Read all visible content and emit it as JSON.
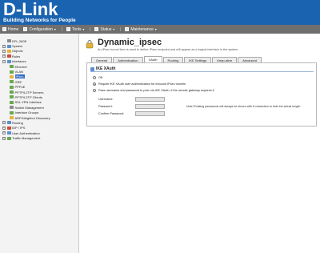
{
  "header": {
    "logo": "D-Link",
    "tagline": "Building Networks for People"
  },
  "menu": {
    "items": [
      {
        "label": "Home"
      },
      {
        "label": "Configuration"
      },
      {
        "label": "Tools"
      },
      {
        "label": "Status"
      },
      {
        "label": "Maintenance"
      }
    ]
  },
  "sidebar": {
    "items": [
      {
        "label": "DFL-260E",
        "depth": 0,
        "toggle": "",
        "icon": "gray"
      },
      {
        "label": "System",
        "depth": 0,
        "toggle": "+",
        "icon": "blue"
      },
      {
        "label": "Objects",
        "depth": 0,
        "toggle": "+",
        "icon": "yellow"
      },
      {
        "label": "Rules",
        "depth": 0,
        "toggle": "+",
        "icon": "red"
      },
      {
        "label": "Interfaces",
        "depth": 0,
        "toggle": "-",
        "icon": "blue"
      },
      {
        "label": "Ethernet",
        "depth": 1,
        "toggle": "",
        "icon": "green"
      },
      {
        "label": "VLAN",
        "depth": 1,
        "toggle": "",
        "icon": "green"
      },
      {
        "label": "IPsec",
        "depth": 1,
        "toggle": "",
        "icon": "yellow",
        "selected": true
      },
      {
        "label": "GRE",
        "depth": 1,
        "toggle": "",
        "icon": "green"
      },
      {
        "label": "PPPoE",
        "depth": 1,
        "toggle": "",
        "icon": "green"
      },
      {
        "label": "PPTP/L2TP Servers",
        "depth": 1,
        "toggle": "",
        "icon": "green"
      },
      {
        "label": "PPTP/L2TP Clients",
        "depth": 1,
        "toggle": "",
        "icon": "green"
      },
      {
        "label": "SSL VPN Interface",
        "depth": 1,
        "toggle": "",
        "icon": "green"
      },
      {
        "label": "Switch Management",
        "depth": 1,
        "toggle": "",
        "icon": "gray"
      },
      {
        "label": "Interface Groups",
        "depth": 1,
        "toggle": "",
        "icon": "green"
      },
      {
        "label": "ARP/Neighbor Discovery",
        "depth": 1,
        "toggle": "",
        "icon": "yellow"
      },
      {
        "label": "Routing",
        "depth": 0,
        "toggle": "+",
        "icon": "blue"
      },
      {
        "label": "IDP / IPS",
        "depth": 0,
        "toggle": "+",
        "icon": "red"
      },
      {
        "label": "User Authentication",
        "depth": 0,
        "toggle": "+",
        "icon": "blue"
      },
      {
        "label": "Traffic Management",
        "depth": 0,
        "toggle": "+",
        "icon": "green"
      }
    ]
  },
  "page": {
    "title": "Dynamic_ipsec",
    "subtitle": "An IPsec tunnel item is used to define IPsec endpoint and will appear as a logical interface in the system."
  },
  "tabs": [
    {
      "label": "General"
    },
    {
      "label": "Authentication"
    },
    {
      "label": "XAuth",
      "active": true
    },
    {
      "label": "Routing"
    },
    {
      "label": "IKE Settings"
    },
    {
      "label": "Keep-alive"
    },
    {
      "label": "Advanced"
    }
  ],
  "xauth": {
    "section_title": "IKE XAuth",
    "options": [
      {
        "label": "Off",
        "checked": false
      },
      {
        "label": "Require IKE XAuth user authentication for inbound IPsec tunnels",
        "checked": true
      },
      {
        "label": "Pass username and password to peer via IKE XAuth, if the remote gateway requires it",
        "checked": false
      }
    ],
    "fields": [
      {
        "label": "Username:",
        "value": ""
      },
      {
        "label": "Password:",
        "value": ""
      },
      {
        "label": "Confirm Password:",
        "value": ""
      }
    ],
    "note": "Note! Existing passwords will always be shown with 8 characters to hide the actual length."
  }
}
